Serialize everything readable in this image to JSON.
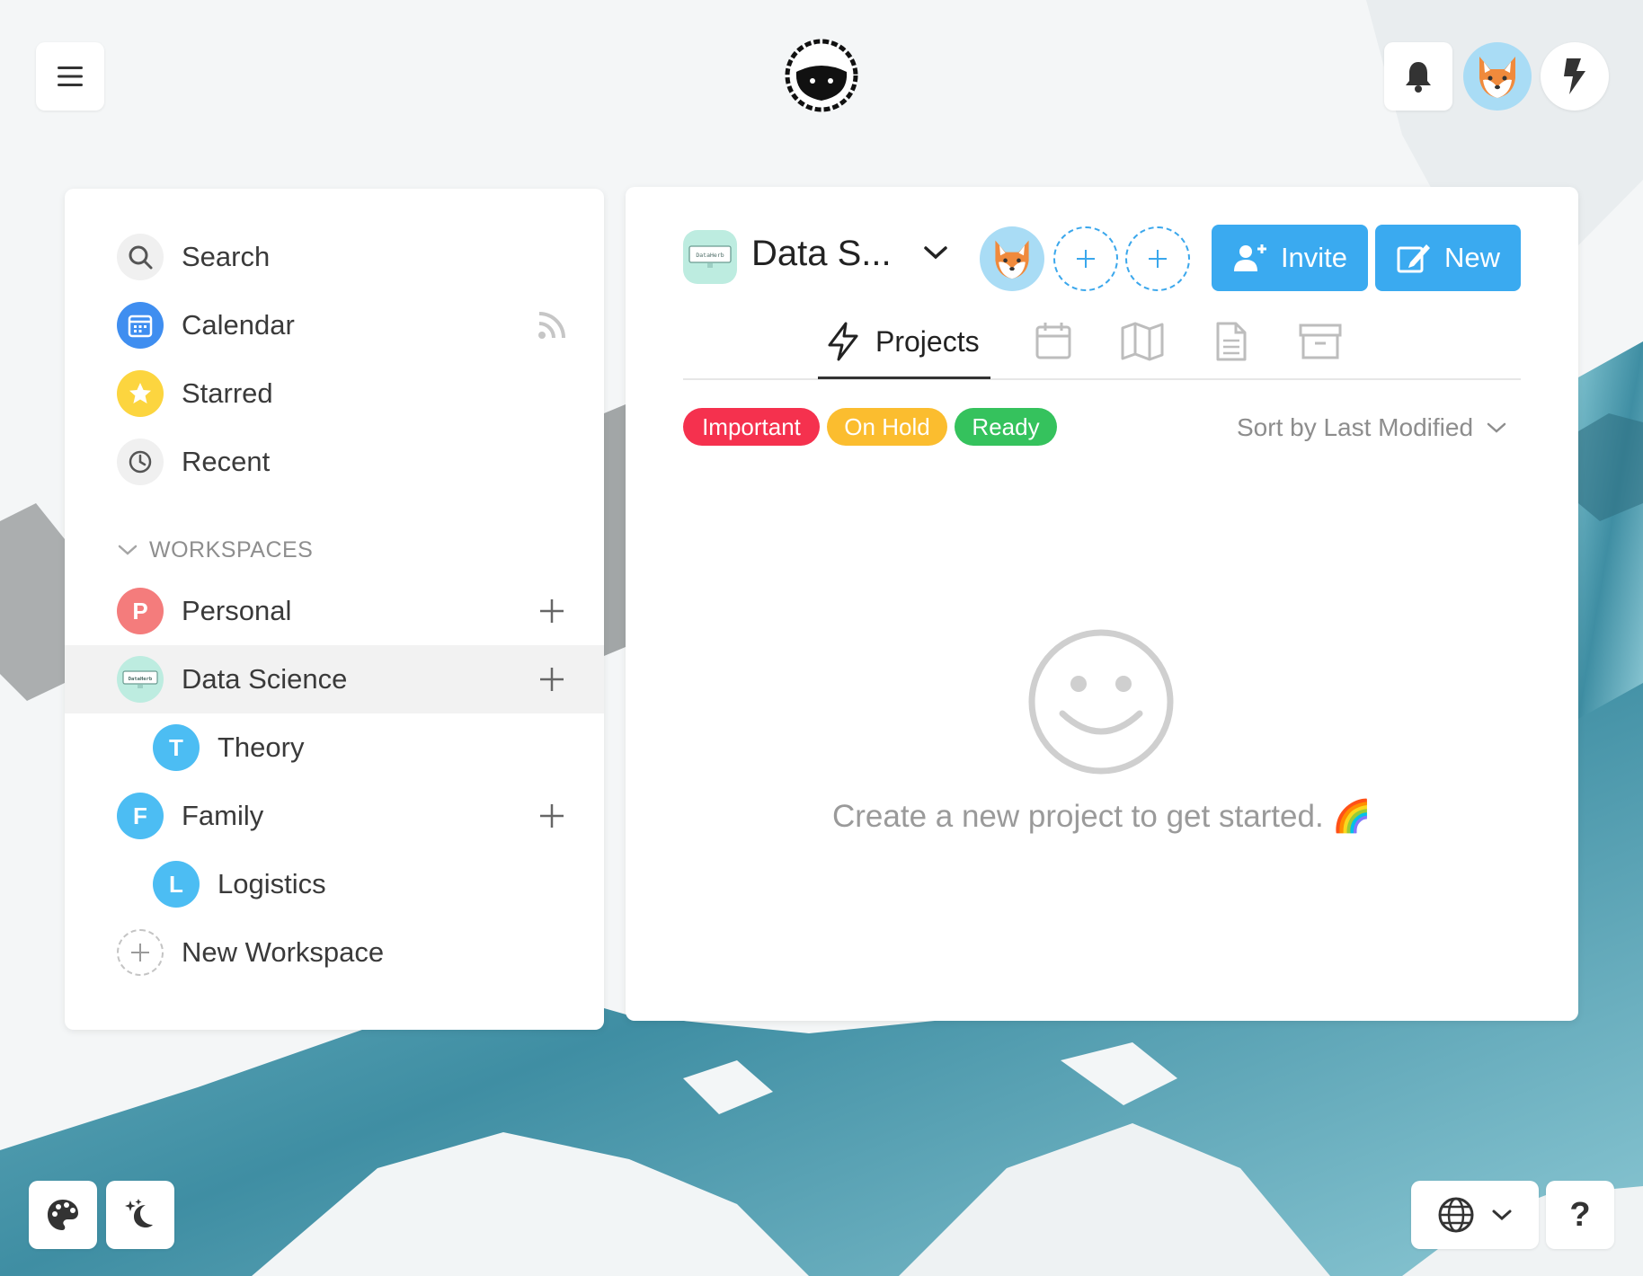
{
  "sidebar": {
    "nav": [
      {
        "label": "Search",
        "icon": "search-icon"
      },
      {
        "label": "Calendar",
        "icon": "calendar-icon"
      },
      {
        "label": "Starred",
        "icon": "star-icon"
      },
      {
        "label": "Recent",
        "icon": "clock-icon"
      }
    ],
    "workspaces_header": "WORKSPACES",
    "workspaces": [
      {
        "label": "Personal",
        "initial": "P",
        "color": "#f47c7c"
      },
      {
        "label": "Data Science",
        "badge_text": "DataHerb"
      },
      {
        "label": "Theory",
        "initial": "T",
        "color": "#4cbdf3"
      },
      {
        "label": "Family",
        "initial": "F",
        "color": "#4cbdf3"
      },
      {
        "label": "Logistics",
        "initial": "L",
        "color": "#4cbdf3"
      }
    ],
    "new_workspace": "New Workspace"
  },
  "main": {
    "workspace_title": "Data S...",
    "workspace_badge_text": "DataHerb",
    "invite_label": "Invite",
    "new_label": "New",
    "tabs": [
      {
        "label": "Projects",
        "icon": "bolt-icon"
      },
      {
        "icon": "calendar-icon"
      },
      {
        "icon": "map-icon"
      },
      {
        "icon": "document-icon"
      },
      {
        "icon": "archive-icon"
      }
    ],
    "tags": [
      {
        "label": "Important",
        "color": "#f5314e"
      },
      {
        "label": "On Hold",
        "color": "#fbbd2f"
      },
      {
        "label": "Ready",
        "color": "#35c25d"
      }
    ],
    "sort_label": "Sort by Last Modified",
    "empty_message": "Create a new project to get started. 🌈"
  },
  "help_label": "?",
  "colors": {
    "accent": "#3aaaf0",
    "calendar": "#3f8ef0",
    "starred": "#fcd53f",
    "workspace_badge": "#bdece0"
  }
}
